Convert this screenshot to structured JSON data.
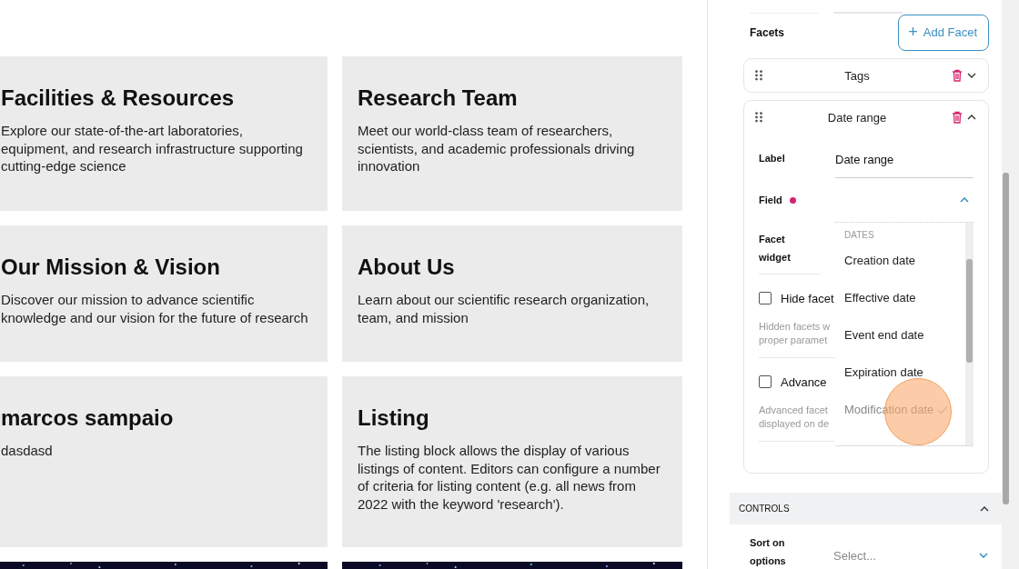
{
  "cards": [
    {
      "title": "Facilities & Resources",
      "description": "Explore our state-of-the-art laboratories, equipment, and research infrastructure supporting cutting-edge science"
    },
    {
      "title": "Research Team",
      "description": "Meet our world-class team of researchers, scientists, and academic professionals driving innovation"
    },
    {
      "title": "Our Mission & Vision",
      "description": "Discover our mission to advance scientific knowledge and our vision for the future of research"
    },
    {
      "title": "About Us",
      "description": "Learn about our scientific research organization, team, and mission"
    },
    {
      "title": "marcos sampaio",
      "description": "dasdasd"
    },
    {
      "title": "Listing",
      "description": "The listing block allows the display of various listings of content. Editors can configure a number of criteria for listing content (e.g. all news from 2022 with the keyword 'research')."
    },
    {
      "kind": "picture"
    },
    {
      "kind": "picture"
    }
  ],
  "sidebar": {
    "facets_label": "Facets",
    "add_button": {
      "icon": "+",
      "label": "Add Facet"
    },
    "facets": [
      {
        "title": "Tags",
        "expanded": false
      },
      {
        "title": "Date range",
        "expanded": true,
        "label_field": {
          "label": "Label",
          "value": "Date range"
        },
        "field": {
          "label": "Field",
          "required": true,
          "open": true
        },
        "facet_widget_label": "Facet widget",
        "checkboxes": [
          {
            "label": "Hide facet",
            "checked": false,
            "help": [
              "Hidden facets w",
              "proper paramet"
            ]
          },
          {
            "label": "Advance",
            "checked": false,
            "help": [
              "Advanced facet",
              "displayed on de"
            ]
          }
        ],
        "dropdown": {
          "group": "DATES",
          "options": [
            {
              "label": "Creation date",
              "selected": false
            },
            {
              "label": "Effective date",
              "selected": false
            },
            {
              "label": "Event end date",
              "selected": false
            },
            {
              "label": "Expiration date",
              "selected": false
            },
            {
              "label": "Modification date",
              "selected": true
            }
          ]
        }
      }
    ],
    "controls": {
      "title": "CONTROLS",
      "expanded": true,
      "sort": {
        "label": "Sort on options",
        "placeholder": "Select..."
      }
    }
  }
}
